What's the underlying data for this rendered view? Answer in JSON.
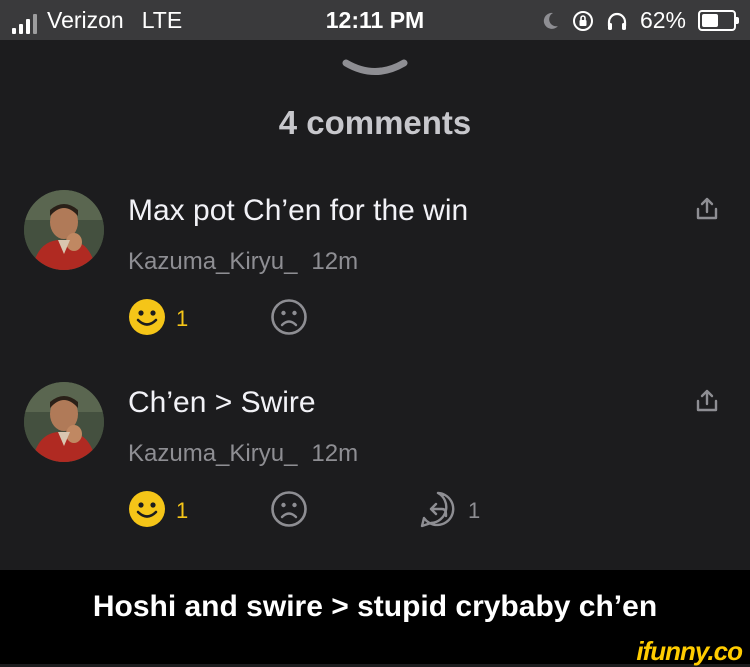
{
  "status_bar": {
    "carrier": "Verizon",
    "network": "LTE",
    "time": "12:11 PM",
    "battery": "62%",
    "battery_level": 0.62
  },
  "sheet": {
    "title": "4 comments"
  },
  "comments": [
    {
      "text": "Max pot Ch’en for the win",
      "author": "Kazuma_Kiryu_",
      "age": "12m",
      "smile_count": "1"
    },
    {
      "text": "Ch’en > Swire",
      "author": "Kazuma_Kiryu_",
      "age": "12m",
      "smile_count": "1",
      "reply_count": "1"
    }
  ],
  "caption": "Hoshi and swire > stupid crybaby ch’en",
  "watermark": "ifunny.co",
  "colors": {
    "background": "#1c1c1e",
    "status_bar": "#3a3a3c",
    "smile": "#f5c518",
    "muted": "#8e8e93"
  }
}
